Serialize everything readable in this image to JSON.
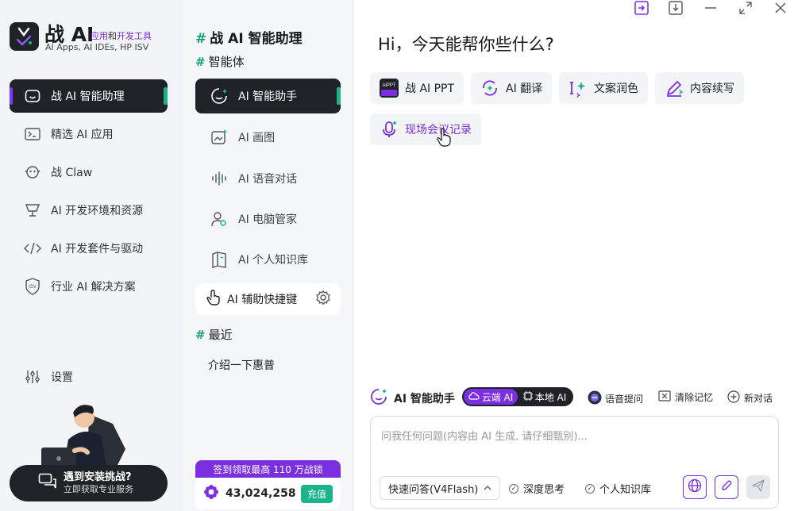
{
  "app": {
    "logo_title": "战 AI",
    "logo_tag_a": "应用",
    "logo_tag_b": "和",
    "logo_tag_c": "开发工具",
    "logo_sub": "AI Apps, AI IDEs, HP ISV"
  },
  "sidebar": {
    "items": [
      {
        "label": "战 AI 智能助理",
        "icon": "assistant-face-icon",
        "active": true
      },
      {
        "label": "精选 AI 应用",
        "icon": "terminal-icon"
      },
      {
        "label": "战 Claw",
        "icon": "claw-bot-icon"
      },
      {
        "label": "AI 开发环境和资源",
        "icon": "lamp-icon"
      },
      {
        "label": "AI 开发套件与驱动",
        "icon": "code-icon"
      },
      {
        "label": "行业 AI 解决方案",
        "icon": "isv-shield-icon"
      }
    ],
    "settings_label": "设置",
    "promo_title": "遇到安装挑战?",
    "promo_sub": "立即获取专业服务"
  },
  "middle": {
    "title": "战 AI 智能助理",
    "agents_heading": "智能体",
    "agents": [
      {
        "label": "AI 智能助手",
        "icon": "assistant-face-icon",
        "active": true
      },
      {
        "label": "AI 画图",
        "icon": "image-sparkle-icon"
      },
      {
        "label": "AI 语音对话",
        "icon": "voice-wave-icon"
      },
      {
        "label": "AI 电脑管家",
        "icon": "user-gear-icon"
      },
      {
        "label": "AI 个人知识库",
        "icon": "book-icon"
      }
    ],
    "quick_label": "AI 辅助快捷键",
    "recent_heading": "最近",
    "recent": [
      "介绍一下惠普"
    ],
    "points_banner": "签到领取最高 110 万战锁",
    "points_value": "43,024,258",
    "recharge_label": "充值"
  },
  "main": {
    "greeting": "Hi，今天能帮你些什么?",
    "chips": [
      {
        "label": "战 AI PPT",
        "icon": "ppt-icon"
      },
      {
        "label": "AI 翻译",
        "icon": "translate-icon"
      },
      {
        "label": "文案润色",
        "icon": "text-polish-icon"
      },
      {
        "label": "内容续写",
        "icon": "pen-icon"
      },
      {
        "label": "现场会议记录",
        "icon": "mic-icon"
      }
    ],
    "assistant_label": "AI 智能助手",
    "mode_cloud": "云端 AI",
    "mode_local": "本地 AI",
    "voice_label": "语音提问",
    "clear_label": "清除记忆",
    "new_chat_label": "新对话",
    "input_placeholder": "问我任何问题(内容由 AI 生成, 请仔细甄别)...",
    "model_select": "快速问答(V4Flash)",
    "deep_think": "深度思考",
    "kb_label": "个人知识库"
  },
  "colors": {
    "accent_purple": "#7a2fe0",
    "accent_green": "#18b48a",
    "dark": "#1f2328"
  }
}
